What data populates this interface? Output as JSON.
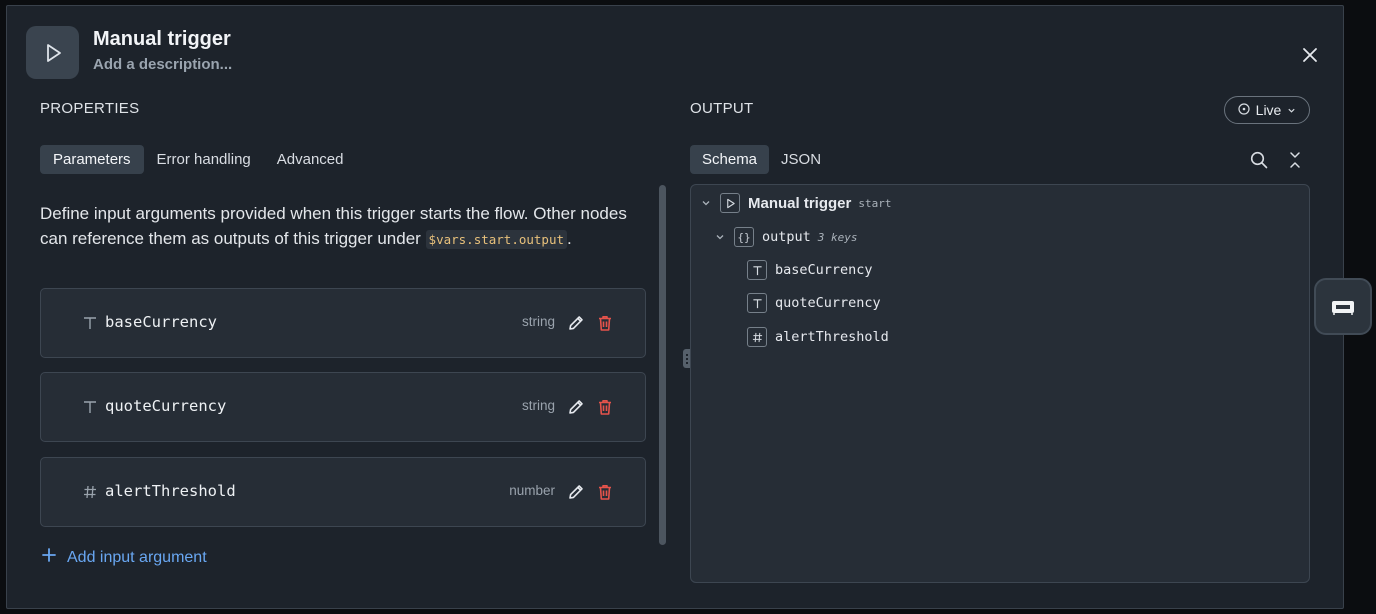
{
  "header": {
    "title": "Manual trigger",
    "description_placeholder": "Add a description..."
  },
  "properties": {
    "heading": "PROPERTIES",
    "tabs": [
      {
        "label": "Parameters",
        "active": true
      },
      {
        "label": "Error handling",
        "active": false
      },
      {
        "label": "Advanced",
        "active": false
      }
    ],
    "intro_text_1": "Define input arguments provided when this trigger starts the flow. Other nodes can reference them as outputs of this trigger under ",
    "intro_code": "$vars.start.output",
    "intro_text_2": ".",
    "arguments": [
      {
        "name": "baseCurrency",
        "type": "string",
        "icon": "text-type-icon"
      },
      {
        "name": "quoteCurrency",
        "type": "string",
        "icon": "text-type-icon"
      },
      {
        "name": "alertThreshold",
        "type": "number",
        "icon": "hash-icon"
      }
    ],
    "add_label": "Add input argument"
  },
  "output": {
    "heading": "OUTPUT",
    "live_label": "Live",
    "tabs": [
      {
        "label": "Schema",
        "active": true
      },
      {
        "label": "JSON",
        "active": false
      }
    ],
    "tree": {
      "root_label": "Manual trigger",
      "root_tag": "start",
      "output_label": "output",
      "output_tag": "3 keys",
      "keys": [
        {
          "name": "baseCurrency",
          "icon": "text-type-icon"
        },
        {
          "name": "quoteCurrency",
          "icon": "text-type-icon"
        },
        {
          "name": "alertThreshold",
          "icon": "hash-icon"
        }
      ]
    }
  },
  "colors": {
    "background": "#1d232b",
    "card": "#262d36",
    "accent_link": "#69a7f2",
    "delete_red": "#e5534b",
    "code_text": "#e7c07b"
  }
}
